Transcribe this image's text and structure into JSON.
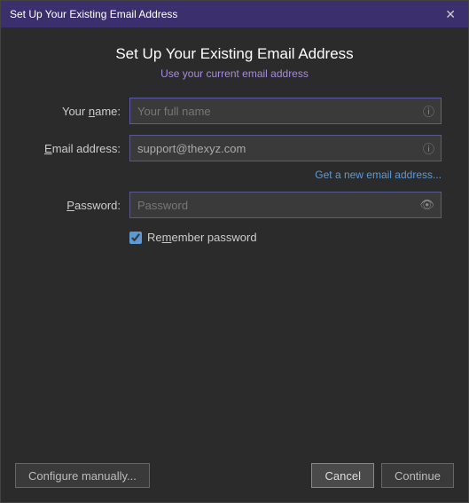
{
  "titlebar": {
    "title": "Set Up Your Existing Email Address",
    "close_label": "✕"
  },
  "header": {
    "title": "Set Up Your Existing Email Address",
    "subtitle": "Use your current email address"
  },
  "form": {
    "name_label": "Your ",
    "name_label_underline": "n",
    "name_label_rest": "ame:",
    "name_placeholder": "Your full name",
    "email_label": "",
    "email_label_underline": "E",
    "email_label_rest": "mail address:",
    "email_value": "support@thexyz.com",
    "get_new_email_link": "Get a new email address...",
    "password_label": "",
    "password_label_underline": "P",
    "password_label_rest": "assword:",
    "password_placeholder": "Password",
    "remember_label_pre": "Re",
    "remember_label_underline": "m",
    "remember_label_rest": "ember password"
  },
  "footer": {
    "configure_label": "Configure manually...",
    "cancel_label": "Cancel",
    "continue_label": "Continue"
  }
}
